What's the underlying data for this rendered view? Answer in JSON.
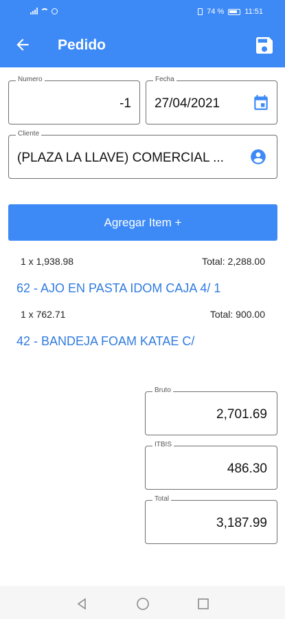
{
  "status_bar": {
    "battery": "74 %",
    "time": "11:51"
  },
  "app_bar": {
    "title": "Pedido",
    "icons": [
      "back-arrow-icon",
      "save-icon"
    ]
  },
  "form": {
    "numero": {
      "label": "Numero",
      "value": "-1"
    },
    "fecha": {
      "label": "Fecha",
      "value": "27/04/2021"
    },
    "cliente": {
      "label": "Cliente",
      "value": "(PLAZA LA LLAVE)  COMERCIAL ..."
    }
  },
  "add_item_label": "Agregar Item +",
  "items": [
    {
      "qty_price": "1 x 1,938.98",
      "total": "Total: 2,288.00",
      "product": "62 - AJO EN PASTA  IDOM CAJA 4/ 1"
    },
    {
      "qty_price": "1 x 762.71",
      "total": "Total: 900.00",
      "product": "42 - BANDEJA FOAM KATAE C/"
    }
  ],
  "totals": {
    "bruto": {
      "label": "Bruto",
      "value": "2,701.69"
    },
    "itbis": {
      "label": "ITBIS",
      "value": "486.30"
    },
    "total": {
      "label": "Total",
      "value": "3,187.99"
    }
  },
  "colors": {
    "primary": "#3d8af7",
    "link": "#2f7be0"
  }
}
